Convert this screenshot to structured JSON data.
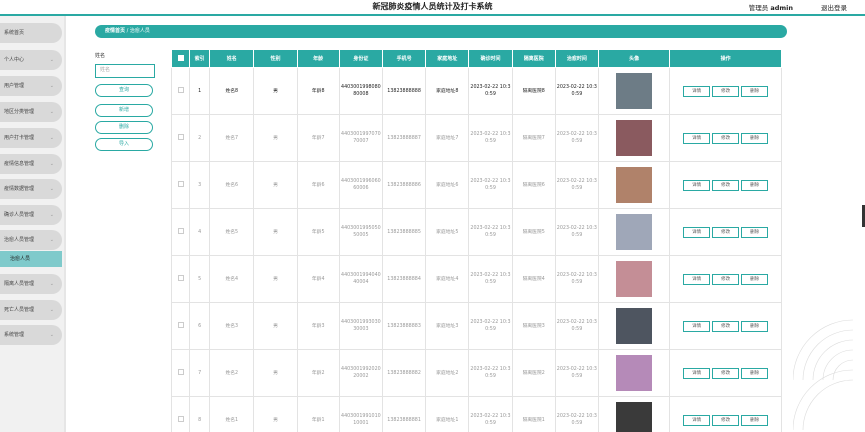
{
  "header": {
    "title": "新冠肺炎疫情人员统计及打卡系统",
    "user_prefix": "管理员",
    "user_name": "admin",
    "logout": "退出登录"
  },
  "colors": {
    "accent": "#2aa9a3",
    "sidebar_active": "#7fcacb"
  },
  "sidebar": {
    "items": [
      {
        "label": "系统首页",
        "chevron": false
      },
      {
        "label": "个人中心",
        "chevron": true
      },
      {
        "label": "用户管理",
        "chevron": true
      },
      {
        "label": "地区分类管理",
        "chevron": true
      },
      {
        "label": "用户打卡管理",
        "chevron": true
      },
      {
        "label": "疫情信息管理",
        "chevron": true
      },
      {
        "label": "疫情数据管理",
        "chevron": true
      },
      {
        "label": "确诊人员管理",
        "chevron": true
      },
      {
        "label": "治愈人员管理",
        "chevron": true
      },
      {
        "label": "隔离人员管理",
        "chevron": true
      },
      {
        "label": "死亡人员管理",
        "chevron": true
      },
      {
        "label": "系统管理",
        "chevron": true
      }
    ],
    "active_sub": "治愈人员"
  },
  "breadcrumb": {
    "home": "疫情首页",
    "separator": "/",
    "current": "治愈人员"
  },
  "search": {
    "label": "姓名",
    "placeholder": "姓名",
    "buttons": [
      "查询",
      "新增",
      "删除",
      "导入"
    ]
  },
  "table": {
    "columns": [
      "",
      "索引",
      "姓名",
      "性别",
      "年龄",
      "身份证",
      "手机号",
      "家庭地址",
      "确诊时间",
      "隔离医院",
      "治愈时间",
      "头像",
      "操作"
    ],
    "actions": [
      "详情",
      "修改",
      "删除"
    ],
    "rows": [
      {
        "index": "1",
        "name": "姓名8",
        "gender": "男",
        "age": "年龄8",
        "id_card": "440300199808080008",
        "phone": "13823888888",
        "address": "家庭地址8",
        "confirm_time": "2023-02-22 10:30:59",
        "hospital": "隔离医院8",
        "cure_time": "2023-02-22 10:30:59",
        "avatar_color": "#6d7c86",
        "avatar": "avatar-man-icon"
      },
      {
        "index": "2",
        "name": "姓名7",
        "gender": "男",
        "age": "年龄7",
        "id_card": "440300199707070007",
        "phone": "13823888887",
        "address": "家庭地址7",
        "confirm_time": "2023-02-22 10:30:59",
        "hospital": "隔离医院7",
        "cure_time": "2023-02-22 10:30:59",
        "avatar_color": "#8a5a5f",
        "avatar": "avatar-woman-icon"
      },
      {
        "index": "3",
        "name": "姓名6",
        "gender": "男",
        "age": "年龄6",
        "id_card": "440300199606060006",
        "phone": "13823888886",
        "address": "家庭地址6",
        "confirm_time": "2023-02-22 10:30:59",
        "hospital": "隔离医院6",
        "cure_time": "2023-02-22 10:30:59",
        "avatar_color": "#b0826a",
        "avatar": "avatar-man-icon"
      },
      {
        "index": "4",
        "name": "姓名5",
        "gender": "男",
        "age": "年龄5",
        "id_card": "440300199505050005",
        "phone": "13823888885",
        "address": "家庭地址5",
        "confirm_time": "2023-02-22 10:30:59",
        "hospital": "隔离医院5",
        "cure_time": "2023-02-22 10:30:59",
        "avatar_color": "#9fa7b8",
        "avatar": "avatar-woman-icon"
      },
      {
        "index": "5",
        "name": "姓名4",
        "gender": "男",
        "age": "年龄4",
        "id_card": "440300199404040004",
        "phone": "13823888884",
        "address": "家庭地址4",
        "confirm_time": "2023-02-22 10:30:59",
        "hospital": "隔离医院4",
        "cure_time": "2023-02-22 10:30:59",
        "avatar_color": "#c48e96",
        "avatar": "avatar-man-icon"
      },
      {
        "index": "6",
        "name": "姓名3",
        "gender": "男",
        "age": "年龄3",
        "id_card": "440300199303030003",
        "phone": "13823888883",
        "address": "家庭地址3",
        "confirm_time": "2023-02-22 10:30:59",
        "hospital": "隔离医院3",
        "cure_time": "2023-02-22 10:30:59",
        "avatar_color": "#4e5560",
        "avatar": "avatar-man-icon"
      },
      {
        "index": "7",
        "name": "姓名2",
        "gender": "男",
        "age": "年龄2",
        "id_card": "440300199202020002",
        "phone": "13823888882",
        "address": "家庭地址2",
        "confirm_time": "2023-02-22 10:30:59",
        "hospital": "隔离医院2",
        "cure_time": "2023-02-22 10:30:59",
        "avatar_color": "#b58ab8",
        "avatar": "avatar-woman-icon"
      },
      {
        "index": "8",
        "name": "姓名1",
        "gender": "男",
        "age": "年龄1",
        "id_card": "440300199101010001",
        "phone": "13823888881",
        "address": "家庭地址1",
        "confirm_time": "2023-02-22 10:30:59",
        "hospital": "隔离医院1",
        "cure_time": "2023-02-22 10:30:59",
        "avatar_color": "#3a3a3a",
        "avatar": "avatar-man-icon"
      }
    ]
  }
}
